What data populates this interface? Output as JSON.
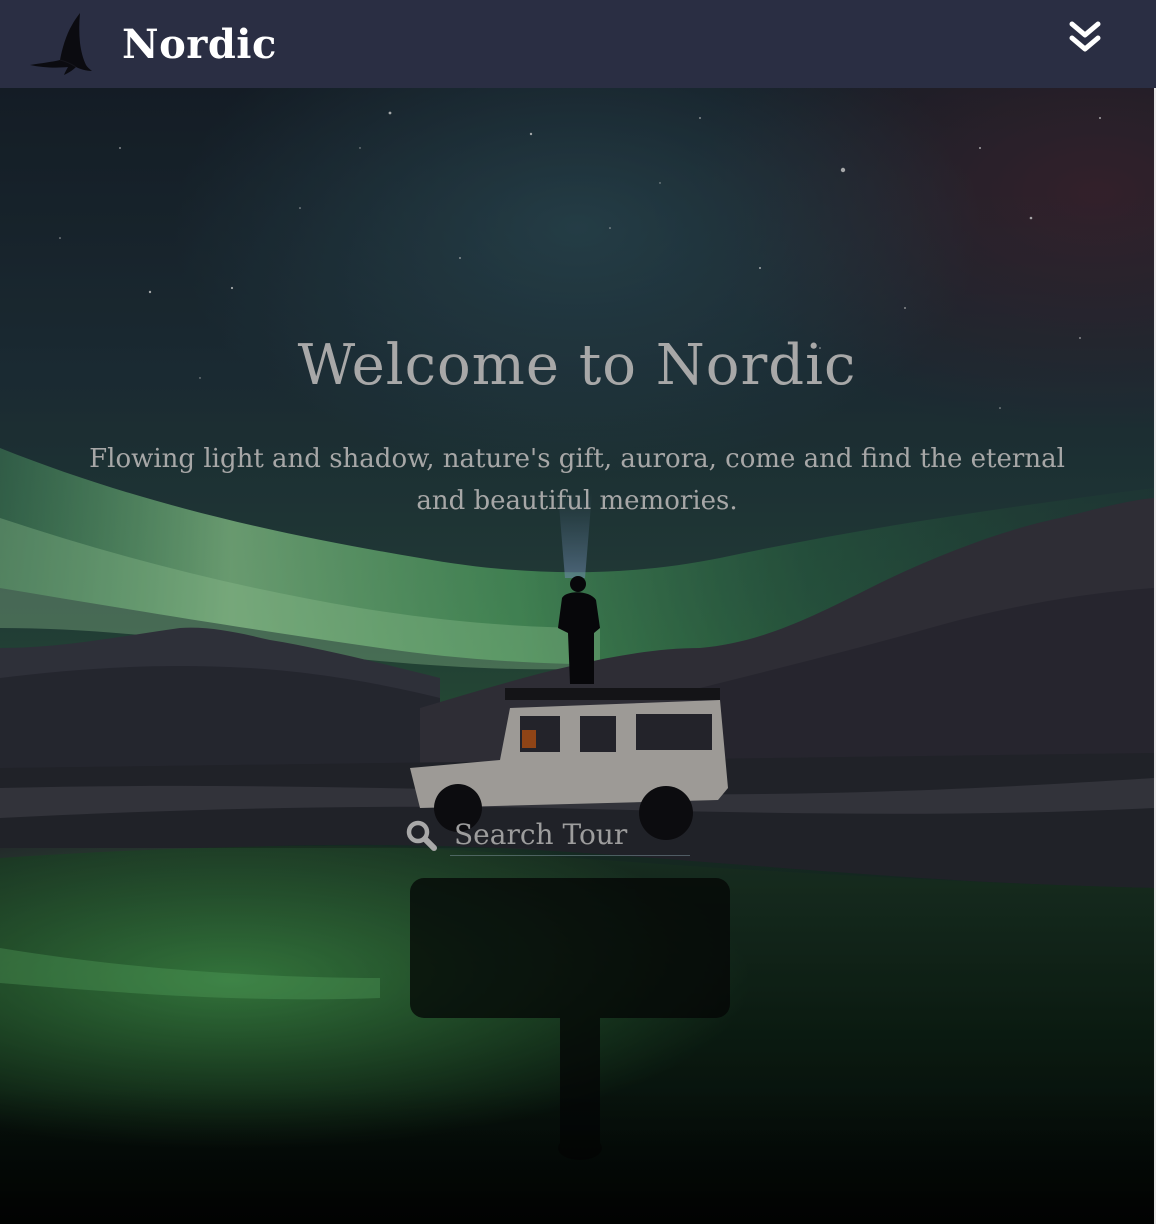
{
  "nav": {
    "brand_name": "Nordic",
    "logo_icon": "bird-silhouette-icon",
    "menu_icon": "double-chevron-down-icon",
    "background_color": "#2a2e43"
  },
  "hero": {
    "title": "Welcome to Nordic",
    "subtitle": "Flowing light and shadow, nature's gift, aurora, come and find the eternal and beautiful memories.",
    "background_description_icon": "aurora-night-landscape-image",
    "search": {
      "icon": "search-icon",
      "placeholder": "Search Tour",
      "value": ""
    }
  },
  "colors": {
    "title_text": "#a8a8a8",
    "aurora_green": "#4fd16a",
    "sky_dark": "#1c2a34"
  }
}
